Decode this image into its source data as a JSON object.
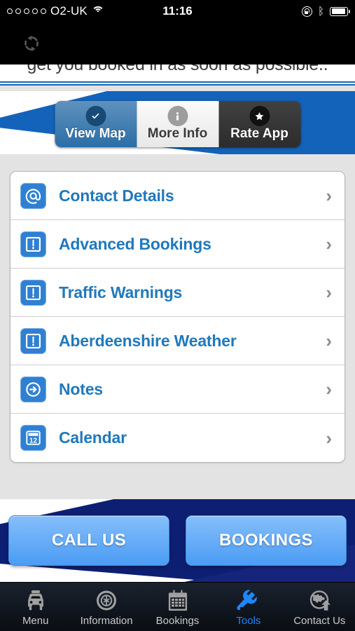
{
  "statusbar": {
    "signal_dots": 5,
    "carrier": "O2-UK",
    "wifi_icon": "wifi-icon",
    "time": "11:16",
    "rotation_lock_icon": "rotation-lock-icon",
    "bluetooth_icon": "bluetooth-icon",
    "bluetooth_glyph": "ᛒ",
    "battery_icon": "battery-icon",
    "battery_level_pct": 82
  },
  "toolbar": {
    "refresh_icon": "refresh-icon"
  },
  "clipped_message": {
    "text": "get you booked in as soon as possible.."
  },
  "segmented_control": {
    "buttons": [
      {
        "id": "view-map",
        "label": "View Map",
        "icon": "check-circle-icon",
        "state": "selected"
      },
      {
        "id": "more-info",
        "label": "More Info",
        "icon": "info-circle-icon",
        "state": "default"
      },
      {
        "id": "rate-app",
        "label": "Rate App",
        "icon": "star-circle-icon",
        "state": "dark"
      }
    ]
  },
  "tools_list": {
    "items": [
      {
        "label": "Contact Details",
        "icon": "at-sign-icon",
        "chevron": "›"
      },
      {
        "label": "Advanced Bookings",
        "icon": "alert-box-icon",
        "chevron": "›"
      },
      {
        "label": "Traffic Warnings",
        "icon": "alert-box-icon",
        "chevron": "›"
      },
      {
        "label": "Aberdeenshire Weather",
        "icon": "alert-box-icon",
        "chevron": "›"
      },
      {
        "label": "Notes",
        "icon": "arrow-circle-icon",
        "chevron": "›"
      },
      {
        "label": "Calendar",
        "icon": "calendar-icon",
        "chevron": "›",
        "calendar_day": "12"
      }
    ]
  },
  "footer_actions": {
    "buttons": [
      {
        "id": "call-us",
        "label": "CALL US"
      },
      {
        "id": "bookings",
        "label": "BOOKINGS"
      }
    ]
  },
  "tabbar": {
    "tabs": [
      {
        "id": "menu",
        "label": "Menu",
        "icon": "taxi-icon",
        "active": false
      },
      {
        "id": "information",
        "label": "Information",
        "icon": "wheel-icon",
        "active": false
      },
      {
        "id": "bookings",
        "label": "Bookings",
        "icon": "calendar-icon",
        "active": false
      },
      {
        "id": "tools",
        "label": "Tools",
        "icon": "wrench-icon",
        "active": true
      },
      {
        "id": "contact-us",
        "label": "Contact Us",
        "icon": "globe-arrow-icon",
        "active": false
      }
    ]
  },
  "colors": {
    "brand_blue": "#1363ba",
    "accent_blue": "#2079bd",
    "navy": "#0d1f72",
    "active_tab": "#1e86f7",
    "icon_blue": "#2f80d2"
  }
}
